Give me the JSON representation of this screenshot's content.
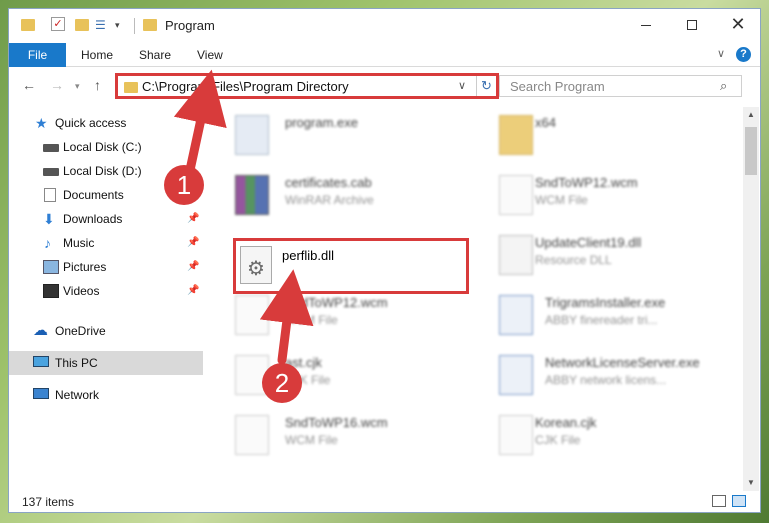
{
  "window": {
    "title": "Program"
  },
  "ribbon": {
    "tabs": [
      "File",
      "Home",
      "Share",
      "View"
    ],
    "help": "?"
  },
  "address": {
    "path": "C:\\Program Files\\Program Directory"
  },
  "search": {
    "placeholder": "Search Program"
  },
  "sidebar": {
    "items": [
      {
        "label": "Quick access",
        "icon": "star-icon"
      },
      {
        "label": "Local Disk (C:)",
        "icon": "disk-icon"
      },
      {
        "label": "Local Disk (D:)",
        "icon": "disk-icon"
      },
      {
        "label": "Documents",
        "icon": "documents-icon"
      },
      {
        "label": "Downloads",
        "icon": "download-icon"
      },
      {
        "label": "Music",
        "icon": "music-icon"
      },
      {
        "label": "Pictures",
        "icon": "pictures-icon"
      },
      {
        "label": "Videos",
        "icon": "videos-icon"
      },
      {
        "label": "OneDrive",
        "icon": "cloud-icon"
      },
      {
        "label": "This PC",
        "icon": "pc-icon"
      },
      {
        "label": "Network",
        "icon": "network-icon"
      }
    ]
  },
  "files": [
    {
      "name": "program.exe",
      "type": ""
    },
    {
      "name": "x64",
      "type": ""
    },
    {
      "name": "certificates.cab",
      "type": "WinRAR Archive"
    },
    {
      "name": "SndToWP12.wcm",
      "type": "WCM File"
    },
    {
      "name": "perflib.dll",
      "type": ""
    },
    {
      "name": "UpdateClient19.dll",
      "type": "Resource DLL"
    },
    {
      "name": "SndToWP12.wcm",
      "type": "WCM File"
    },
    {
      "name": "TrigramsInstaller.exe",
      "type": "ABBY finereader tri..."
    },
    {
      "name": "ast.cjk",
      "type": "CJK File"
    },
    {
      "name": "NetworkLicenseServer.exe",
      "type": "ABBY network licens..."
    },
    {
      "name": "SndToWP16.wcm",
      "type": "WCM File"
    },
    {
      "name": "Korean.cjk",
      "type": "CJK File"
    }
  ],
  "status": {
    "count": "137 items"
  },
  "annotations": {
    "step1": "1",
    "step2": "2",
    "color": "#d83b3b"
  }
}
